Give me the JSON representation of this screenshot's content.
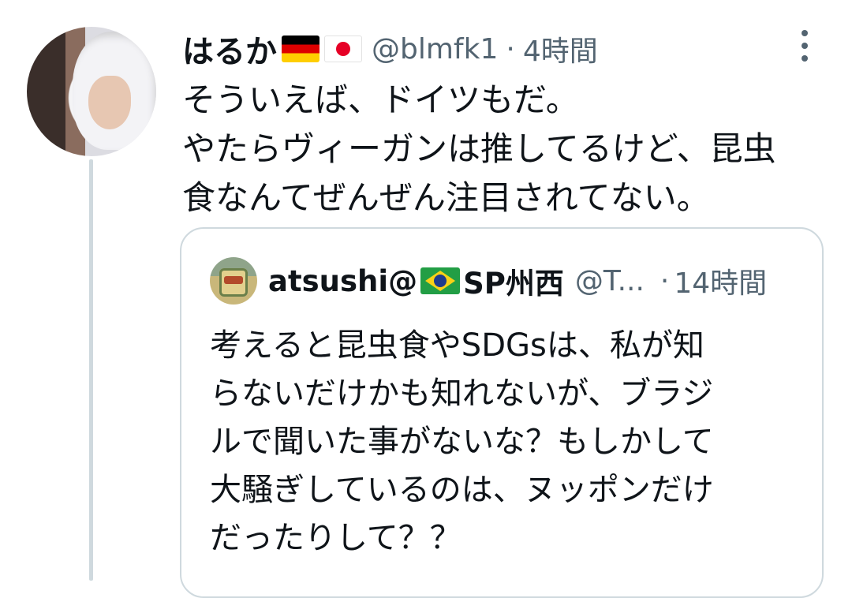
{
  "tweet": {
    "author_name": "はるか",
    "author_flags": [
      "germany-flag",
      "japan-flag"
    ],
    "handle": "@blmfk1",
    "separator": "·",
    "time": "4時間",
    "text_lines": [
      "そういえば、ドイツもだ。",
      "やたらヴィーガンは推してるけど、昆虫",
      "食なんてぜんぜん注目されてない。"
    ]
  },
  "quoted_tweet": {
    "author_name_prefix": "atsushi@",
    "author_flag": "brazil-flag",
    "author_name_suffix": "SP州西",
    "handle": "@T...",
    "separator": "·",
    "time": "14時間",
    "text_lines": [
      "考えると昆虫食やSDGsは、私が知",
      "らないだけかも知れないが、ブラジ",
      "ルで聞いた事がないな？もしかして",
      "大騒ぎしているのは、ヌッポンだけ",
      "だったりして？？"
    ]
  },
  "colors": {
    "text_primary": "#0f1419",
    "text_secondary": "#536471",
    "border": "#cfd9de"
  }
}
